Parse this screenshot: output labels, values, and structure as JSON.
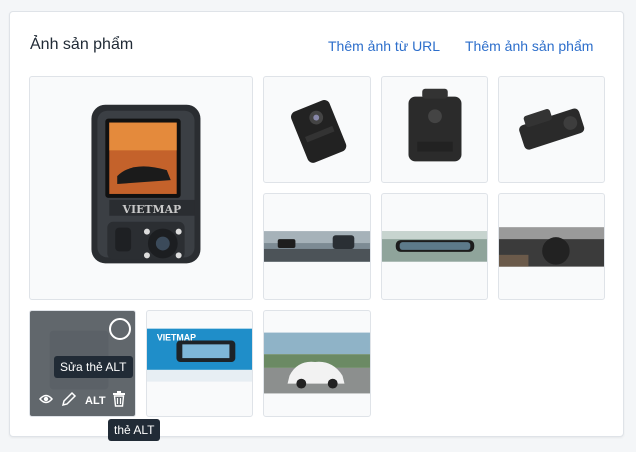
{
  "header": {
    "title": "Ảnh sản phẩm",
    "add_from_url": "Thêm ảnh từ URL",
    "add_image": "Thêm ảnh sản phẩm"
  },
  "main_image": {
    "brand": "VIETMAP"
  },
  "hover_actions": {
    "edit_alt_tooltip": "Sửa thẻ ALT",
    "alt_label": "ALT",
    "alt_tooltip": "thẻ ALT"
  },
  "thumbnails": {
    "banner": {
      "brand": "VIETMAP"
    }
  }
}
